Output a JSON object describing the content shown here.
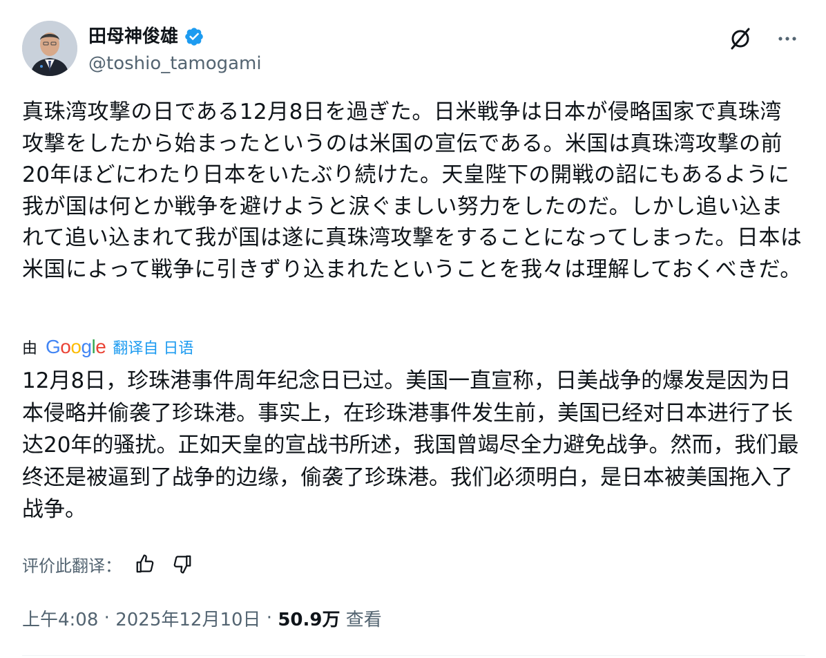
{
  "author": {
    "display_name": "田母神俊雄",
    "handle": "@toshio_tamogami",
    "verified": true
  },
  "icons": {
    "verified": "verified-badge-icon",
    "grok": "grok-icon",
    "more": "more-icon",
    "thumb_up": "thumbs-up-icon",
    "thumb_down": "thumbs-down-icon"
  },
  "colors": {
    "accent": "#1d9bf0",
    "secondary_text": "#536471",
    "primary_text": "#0f1419"
  },
  "post": {
    "original_text": "真珠湾攻撃の日である12月8日を過ぎた。日米戦争は日本が侵略国家で真珠湾攻撃をしたから始まったというのは米国の宣伝である。米国は真珠湾攻撃の前20年ほどにわたり日本をいたぶり続けた。天皇陛下の開戦の詔にもあるように我が国は何とか戦争を避けようと涙ぐましい努力をしたのだ。しかし追い込まれて追い込まれて我が国は遂に真珠湾攻撃をすることになってしまった。日本は米国によって戦争に引きずり込まれたということを我々は理解しておくべきだ。",
    "translated_by_prefix": "由",
    "translated_by_logo": "Google",
    "translate_link": "翻译自 日语",
    "translated_text": "12月8日，珍珠港事件周年纪念日已过。美国一直宣称，日美战争的爆发是因为日本侵略并偷袭了珍珠港。事实上，在珍珠港事件发生前，美国已经对日本进行了长达20年的骚扰。正如天皇的宣战书所述，我国曾竭尽全力避免战争。然而，我们最终还是被逼到了战争的边缘，偷袭了珍珠港。我们必须明白，是日本被美国拖入了战争。",
    "rate_translation_label": "评价此翻译："
  },
  "meta": {
    "time": "上午4:08",
    "separator": " · ",
    "date": "2025年12月10日",
    "views_count": "50.9万",
    "views_label": "查看"
  }
}
